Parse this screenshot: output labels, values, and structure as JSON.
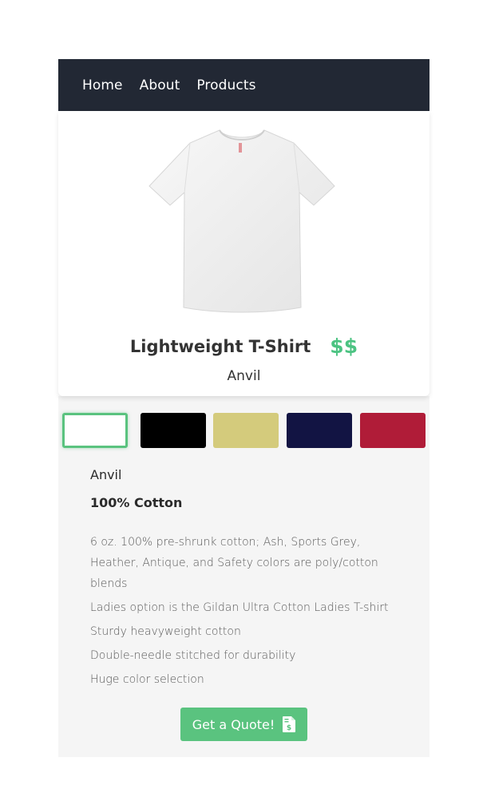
{
  "nav": {
    "items": [
      {
        "label": "Home"
      },
      {
        "label": "About"
      },
      {
        "label": "Products"
      }
    ]
  },
  "product": {
    "title": "Lightweight T-Shirt",
    "price": "$$",
    "brand": "Anvil",
    "image_icon": "white-t-shirt"
  },
  "swatches": [
    {
      "color": "#ffffff",
      "selected": true
    },
    {
      "color": "#000000",
      "selected": false
    },
    {
      "color": "#d4cb7c",
      "selected": false
    },
    {
      "color": "#121443",
      "selected": false
    },
    {
      "color": "#b01c38",
      "selected": false
    }
  ],
  "details": {
    "brand": "Anvil",
    "material": "100% Cotton",
    "features": [
      "6 oz. 100% pre-shrunk cotton; Ash, Sports Grey, Heather, Antique, and Safety colors are poly/cotton blends",
      "Ladies option is the Gildan Ultra Cotton Ladies T-shirt",
      "Sturdy heavyweight cotton",
      "Double-needle stitched for durability",
      "Huge color selection"
    ]
  },
  "quote_button": {
    "label": "Get a Quote!",
    "icon": "invoice-dollar-icon"
  },
  "colors": {
    "nav_bg": "#222834",
    "accent": "#5ac37f",
    "price": "#4cc382",
    "details_bg": "#f5f5f5"
  }
}
